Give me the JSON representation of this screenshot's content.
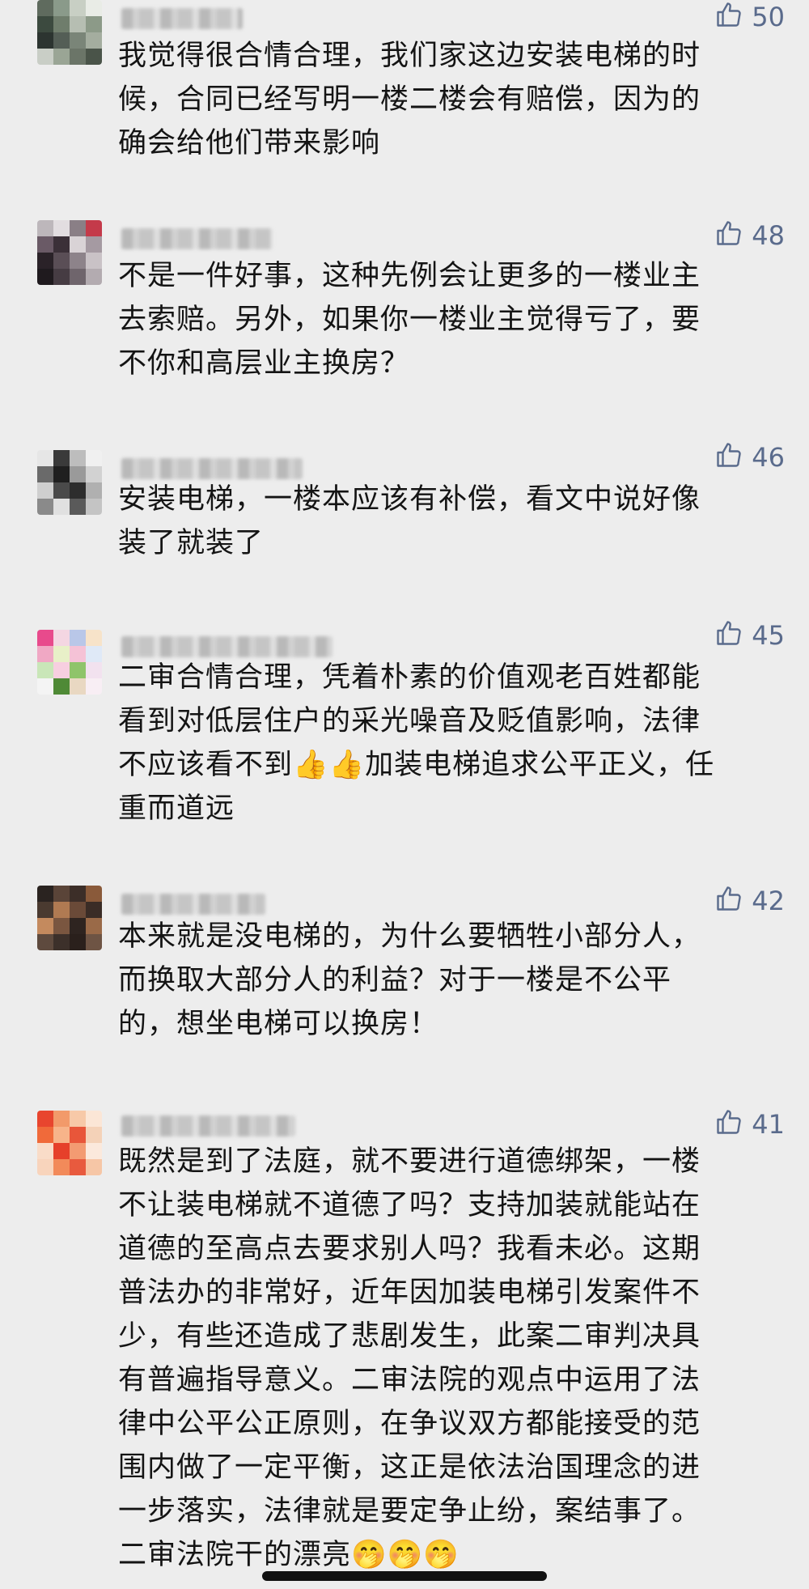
{
  "comments": [
    {
      "likes": "50",
      "text": "我觉得很合情合理，我们家这边安装电梯的时\n候，合同已经写明一楼二楼会有赔偿，因为的\n确会给他们带来影响",
      "avatar_colors": [
        "#5f6b5e",
        "#8a9a8a",
        "#c8cfc4",
        "#e9ece6",
        "#3c4a3f",
        "#6f7d6c",
        "#b6beb2",
        "#8c9a88",
        "#2c3430",
        "#545e56",
        "#7a8578",
        "#a4ad9f",
        "#c9cec6",
        "#9aa595",
        "#6b7568",
        "#4a5449"
      ]
    },
    {
      "likes": "48",
      "text": "不是一件好事，这种先例会让更多的一楼业主\n去索赔。另外，如果你一楼业主觉得亏了，要\n不你和高层业主换房？",
      "avatar_colors": [
        "#bdb7bb",
        "#e2dde0",
        "#8a7f86",
        "#c43a4a",
        "#6a5a66",
        "#3b3038",
        "#d9d3d6",
        "#a59aa2",
        "#2a2228",
        "#5a4e56",
        "#8d838a",
        "#c9c2c6",
        "#1f1a1e",
        "#463c43",
        "#6f656c",
        "#b3abb0"
      ]
    },
    {
      "likes": "46",
      "text": "安装电梯，一楼本应该有补偿，看文中说好像\n装了就装了",
      "avatar_colors": [
        "#e6e6e6",
        "#3a3a3a",
        "#bdbdbd",
        "#f0f0f0",
        "#6a6a6a",
        "#1f1f1f",
        "#9a9a9a",
        "#d2d2d2",
        "#cfcfcf",
        "#4a4a4a",
        "#2d2d2d",
        "#b0b0b0",
        "#8a8a8a",
        "#e0e0e0",
        "#5a5a5a",
        "#c4c4c4"
      ]
    },
    {
      "likes": "45",
      "text": "二审合情合理，凭着朴素的价值观老百姓都能\n看到对低层住户的采光噪音及贬值影响，法律\n不应该看不到👍👍加装电梯追求公平正义，任\n重而道远",
      "avatar_colors": [
        "#e84a8c",
        "#f4d6e2",
        "#b9c7e8",
        "#f7e3c9",
        "#f0a8c4",
        "#e8f0c8",
        "#f5c2d6",
        "#dfe9f7",
        "#c9e6b8",
        "#f7cfe0",
        "#8fc46a",
        "#f2e2ef",
        "#f4f4f4",
        "#4f8a36",
        "#e9d8c2",
        "#f8eef4"
      ]
    },
    {
      "likes": "42",
      "text": "本来就是没电梯的，为什么要牺牲小部分人，\n而换取大部分人的利益？对于一楼是不公平\n的，想坐电梯可以换房！",
      "avatar_colors": [
        "#2a2320",
        "#5a4438",
        "#3c2e28",
        "#8a5a3a",
        "#4a3a30",
        "#b07a52",
        "#6a4a38",
        "#3a2c26",
        "#c48a5e",
        "#7a5640",
        "#2e2420",
        "#9a6a48",
        "#5e4a3e",
        "#3c302a",
        "#2a201c",
        "#6e5444"
      ]
    },
    {
      "likes": "41",
      "text": "既然是到了法庭，就不要进行道德绑架，一楼\n不让装电梯就不道德了吗？支持加装就能站在\n道德的至高点去要求别人吗？我看未必。这期\n普法办的非常好，近年因加装电梯引发案件不\n少，有些还造成了悲剧发生，此案二审判决具\n有普遍指导意义。二审法院的观点中运用了法\n律中公平公正原则，在争议双方都能接受的范\n围内做了一定平衡，这正是依法治国理念的进\n一步落实，法律就是要定争止纷，案结事了。\n二审法院干的漂亮🤭🤭🤭",
      "avatar_colors": [
        "#e8452e",
        "#f29a6a",
        "#f7c9a8",
        "#fbe6d6",
        "#f06a3a",
        "#f7b48a",
        "#e8563a",
        "#f4d2b8",
        "#f9dcc8",
        "#e6402a",
        "#f39b72",
        "#fbe9dc",
        "#f8d4bc",
        "#f28a5a",
        "#e85a3e",
        "#f6c6a6"
      ]
    }
  ]
}
